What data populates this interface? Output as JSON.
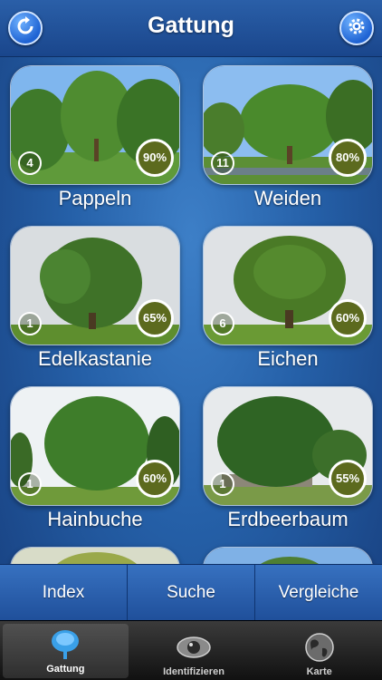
{
  "header": {
    "title": "Gattung",
    "refresh_icon": "refresh-icon",
    "settings_icon": "gear-icon"
  },
  "genera": [
    {
      "name": "Pappeln",
      "count": "4",
      "percent": "90%"
    },
    {
      "name": "Weiden",
      "count": "11",
      "percent": "80%"
    },
    {
      "name": "Edelkastanie",
      "count": "1",
      "percent": "65%"
    },
    {
      "name": "Eichen",
      "count": "6",
      "percent": "60%"
    },
    {
      "name": "Hainbuche",
      "count": "1",
      "percent": "60%"
    },
    {
      "name": "Erdbeerbaum",
      "count": "1",
      "percent": "55%"
    }
  ],
  "segments": {
    "index": "Index",
    "search": "Suche",
    "compare": "Vergleiche"
  },
  "tabs": [
    {
      "label": "Gattung",
      "icon": "tree-icon"
    },
    {
      "label": "Identifizieren",
      "icon": "eye-icon"
    },
    {
      "label": "Karte",
      "icon": "globe-icon"
    }
  ],
  "colors": {
    "accent": "#2560a8",
    "badge": "#5c6a1e"
  }
}
